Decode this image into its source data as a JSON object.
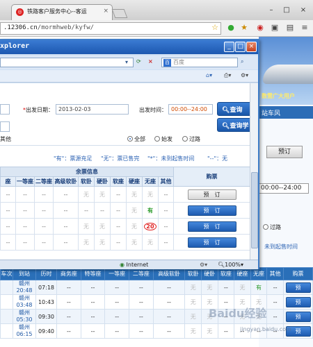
{
  "browser": {
    "tab_title": "铁路客户服务中心--客运",
    "url_prefix": ".12306.cn",
    "url_path": "/mormhweb/kyfw/"
  },
  "bg": {
    "banner_text": "数需广大用户",
    "nav_text": "站车风",
    "btn_yuding": "预订",
    "time_select": "00:00--24:00",
    "radio_guolu": "过路",
    "legend_right": "未到起售时间",
    "table_headers": [
      "车次",
      "到站",
      "历时",
      "商务座",
      "特等座",
      "一等座",
      "二等座",
      "高级软卧",
      "软卧",
      "硬卧",
      "软座",
      "硬座",
      "无座",
      "其他",
      "购票"
    ],
    "rows": [
      {
        "station": "赣州",
        "time": "20:48",
        "duration": "07:18",
        "cells": [
          "--",
          "--",
          "--",
          "--",
          "--",
          "无",
          "无",
          "--",
          "无",
          "有",
          "--"
        ],
        "btn": "预"
      },
      {
        "station": "赣州",
        "time": "03:48",
        "duration": "10:43",
        "cells": [
          "--",
          "--",
          "--",
          "--",
          "--",
          "无",
          "无",
          "--",
          "无",
          "无",
          "--"
        ],
        "btn": "预"
      },
      {
        "station": "赣州",
        "time": "05:30",
        "duration": "09:30",
        "cells": [
          "--",
          "--",
          "--",
          "--",
          "--",
          "无",
          "无",
          "--",
          "无",
          "无",
          "--"
        ],
        "btn": "预"
      },
      {
        "station": "赣州",
        "time": "06:15",
        "duration": "09:40",
        "cells": [
          "--",
          "--",
          "--",
          "--",
          "--",
          "无",
          "无",
          "--",
          "--",
          "--",
          "--"
        ],
        "btn": "预"
      }
    ]
  },
  "ie": {
    "title": "xplorer",
    "search_placeholder": "百度",
    "form": {
      "date_label": "出发日期：",
      "date_value": "2013-02-03",
      "time_label": "出发时间：",
      "time_value": "00:00--24:00",
      "query_btn": "查询",
      "query_student_btn": "查询学",
      "other_label": "其他",
      "radio_all": "全部",
      "radio_start": "始发",
      "radio_pass": "过路"
    },
    "legend": {
      "you": "\"有\"：票源充足",
      "wu": "\"无\"：票已售完",
      "star": "\"*\"：未到起售时间",
      "dash": "\"--\"：无"
    },
    "table": {
      "group_header": "余票信息",
      "buy_header": "购票",
      "headers": [
        "座",
        "一等座",
        "二等座",
        "高级软卧",
        "软卧",
        "硬卧",
        "软座",
        "硬座",
        "无座",
        "其他"
      ],
      "rows": [
        {
          "cells": [
            "--",
            "--",
            "--",
            "--",
            "无",
            "无",
            "--",
            "无",
            "无",
            "--"
          ],
          "btn": "预　订",
          "style": "gray"
        },
        {
          "cells": [
            "--",
            "--",
            "--",
            "--",
            "--",
            "--",
            "--",
            "无",
            "有",
            "--"
          ],
          "btn": "预　订",
          "style": "blue"
        },
        {
          "cells": [
            "--",
            "--",
            "--",
            "--",
            "无",
            "无",
            "--",
            "无",
            "20",
            "--"
          ],
          "btn": "预　订",
          "style": "blue"
        },
        {
          "cells": [
            "--",
            "--",
            "--",
            "--",
            "无",
            "无",
            "--",
            "无",
            "无",
            "--"
          ],
          "btn": "预　订",
          "style": "blue"
        }
      ]
    },
    "status": {
      "zone": "Internet",
      "zoom": "100%"
    }
  },
  "watermark": {
    "site": "Baidu经验",
    "url": "jingyan.baidu.com"
  }
}
